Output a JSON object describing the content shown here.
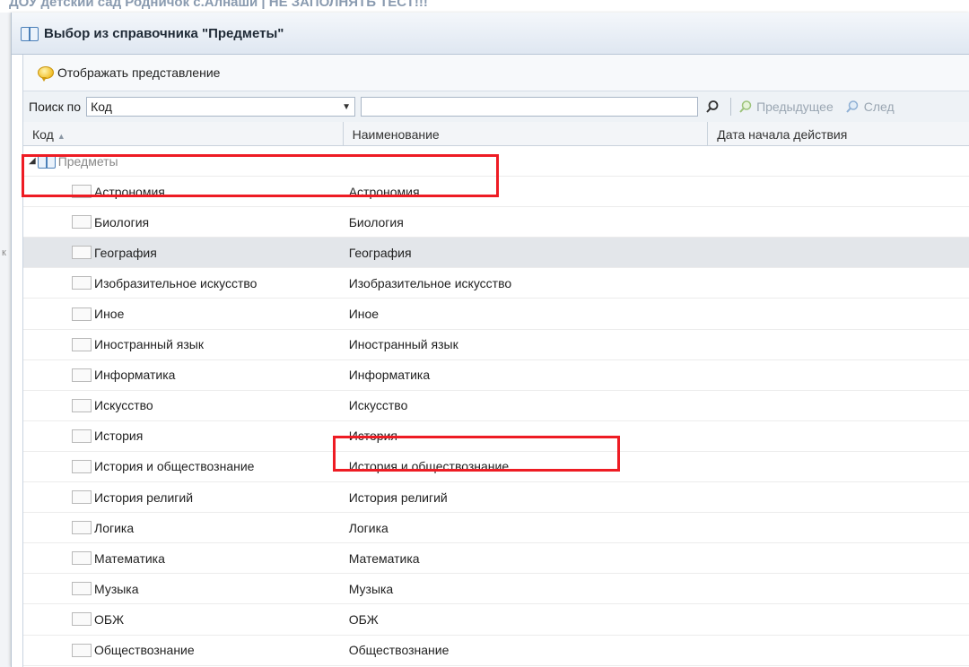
{
  "background": {
    "title": "ДОУ детский сад Родничок с.Алнаши | НЕ ЗАПОЛНЯТЬ ТЕСТ!!!",
    "left_marks": [
      "к"
    ]
  },
  "dialog": {
    "title": "Выбор из справочника \"Предметы\"",
    "toolbar": {
      "show_view_label": "Отображать представление"
    },
    "search": {
      "label": "Поиск по",
      "field_value": "Код",
      "query_value": "",
      "prev_label": "Предыдущее",
      "next_label": "След"
    },
    "columns": [
      "Код",
      "Наименование",
      "Дата начала действия"
    ],
    "root": {
      "label": "Предметы"
    },
    "rows": [
      {
        "code": "Астрономия",
        "name": "Астрономия"
      },
      {
        "code": "Биология",
        "name": "Биология"
      },
      {
        "code": "География",
        "name": "География"
      },
      {
        "code": "Изобразительное искусство",
        "name": "Изобразительное искусство"
      },
      {
        "code": "Иное",
        "name": "Иное"
      },
      {
        "code": "Иностранный язык",
        "name": "Иностранный язык"
      },
      {
        "code": "Информатика",
        "name": "Информатика"
      },
      {
        "code": "Искусство",
        "name": "Искусство"
      },
      {
        "code": "История",
        "name": "История"
      },
      {
        "code": "История и обществознание",
        "name": "История и обществознание"
      },
      {
        "code": "История религий",
        "name": "История религий"
      },
      {
        "code": "Логика",
        "name": "Логика"
      },
      {
        "code": "Математика",
        "name": "Математика"
      },
      {
        "code": "Музыка",
        "name": "Музыка"
      },
      {
        "code": "ОБЖ",
        "name": "ОБЖ"
      },
      {
        "code": "Обществознание",
        "name": "Обществознание"
      }
    ],
    "selected_row": "География"
  },
  "colors": {
    "annotation": "#ee1c24",
    "selected_row": "#e3e6ea",
    "header_gradient": "#dfe7f1",
    "book_icon": "#4a7fb8"
  }
}
